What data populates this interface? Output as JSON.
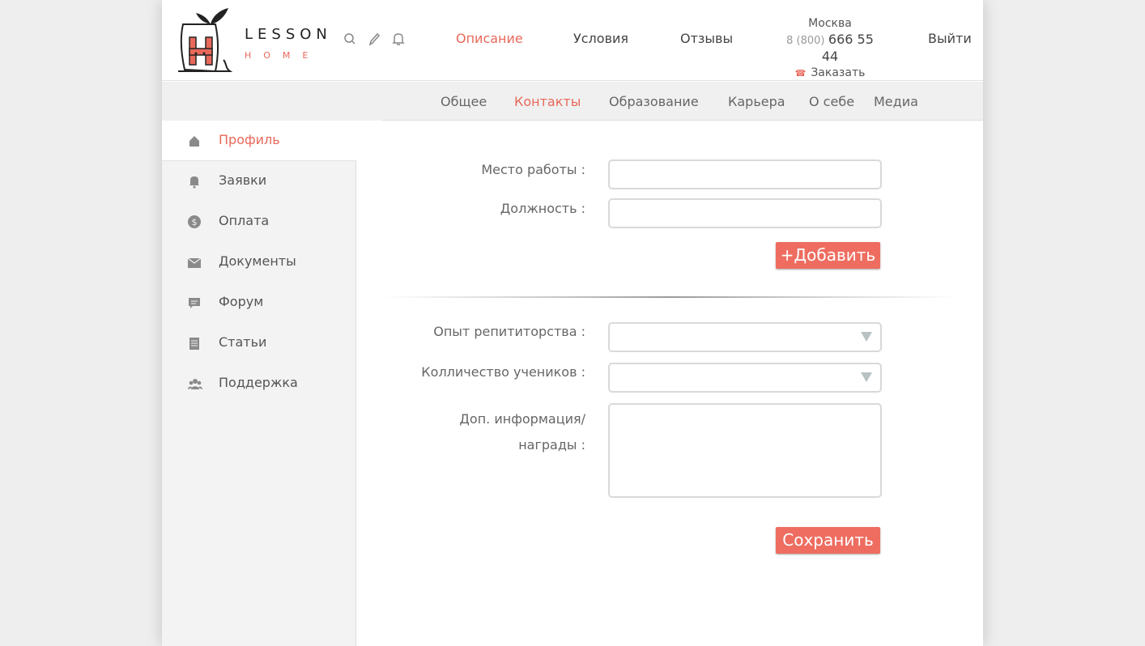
{
  "brand": {
    "logo_top": "LESSON",
    "logo_bottom": "HOME",
    "accent_color": "#e8685a"
  },
  "header": {
    "icons": [
      "search-icon",
      "pencil-icon",
      "bell-icon"
    ],
    "nav": [
      {
        "label": "Описание",
        "active": true
      },
      {
        "label": "Условия",
        "active": false
      },
      {
        "label": "Отзывы",
        "active": false
      }
    ],
    "contact": {
      "city": "Москва",
      "phone_prefix": "8 (800)",
      "phone": "666 55 44",
      "callback_label": "Заказать звонок"
    },
    "logout_label": "Выйти"
  },
  "subnav": {
    "tabs": [
      {
        "label": "Общее",
        "active": false
      },
      {
        "label": "Контакты",
        "active": true
      },
      {
        "label": "Образование",
        "active": false
      },
      {
        "label": "Карьера",
        "active": false
      },
      {
        "label": "О себе",
        "active": false
      },
      {
        "label": "Медиа",
        "active": false
      }
    ]
  },
  "sidebar": {
    "items": [
      {
        "label": "Профиль",
        "icon": "home-icon",
        "active": true
      },
      {
        "label": "Заявки",
        "icon": "bell-icon",
        "active": false
      },
      {
        "label": "Оплата",
        "icon": "dollar-icon",
        "active": false
      },
      {
        "label": "Документы",
        "icon": "envelope-icon",
        "active": false
      },
      {
        "label": "Форум",
        "icon": "chat-icon",
        "active": false
      },
      {
        "label": "Статьи",
        "icon": "document-icon",
        "active": false
      },
      {
        "label": "Поддержка",
        "icon": "users-icon",
        "active": false
      }
    ]
  },
  "form": {
    "workplace_label": "Место работы :",
    "workplace_value": "",
    "position_label": "Должность :",
    "position_value": "",
    "add_button": "+Добавить",
    "experience_label": "Опыт репититорства :",
    "experience_value": "",
    "students_label": "Колличество учеников :",
    "students_value": "",
    "extra_label_line1": "Доп. информация/",
    "extra_label_line2": "награды :",
    "extra_value": "",
    "save_button": "Сохранить"
  }
}
